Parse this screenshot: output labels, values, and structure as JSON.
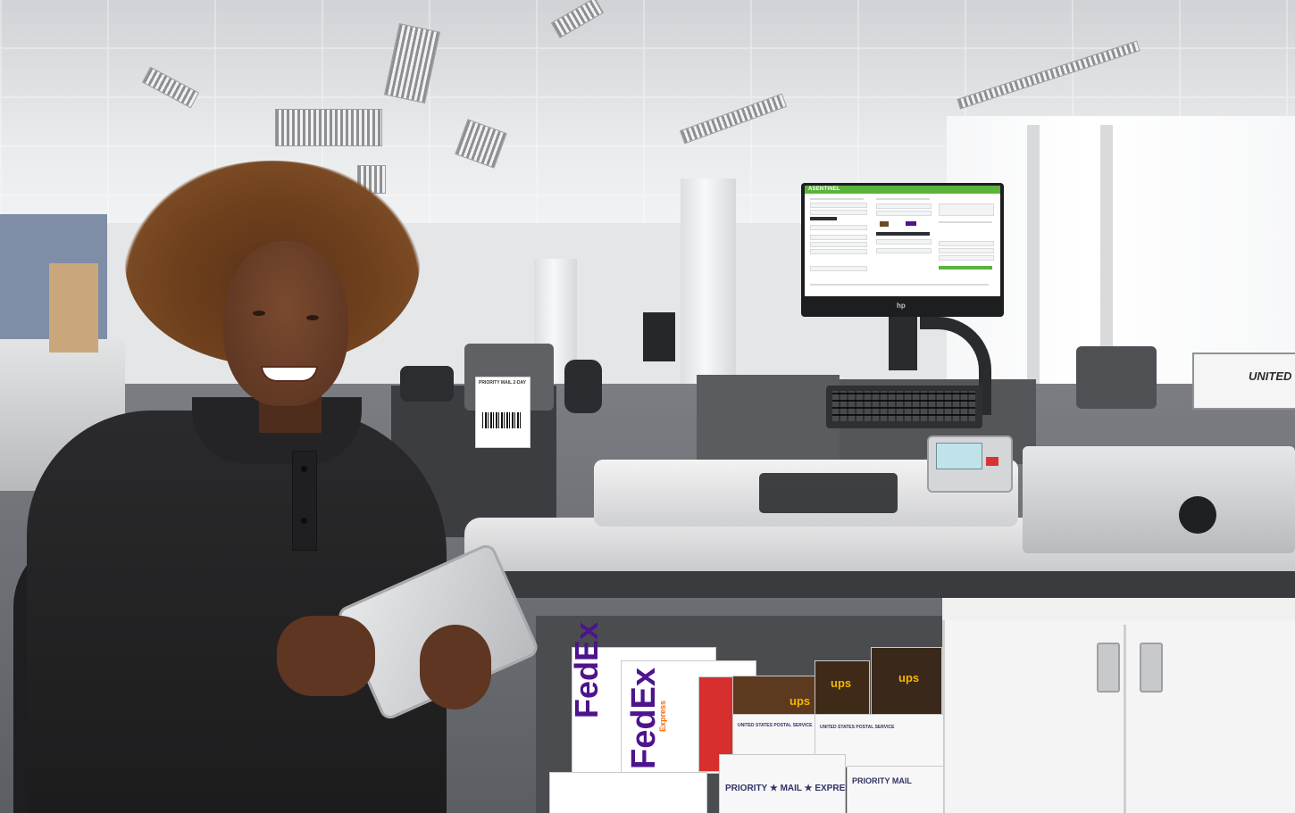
{
  "scene": {
    "description_free": true,
    "monitor": {
      "app_title": "ASENTINEL",
      "brand_logo": "hp"
    },
    "shipping_label": {
      "text": "PRIORITY MAIL 2-DAY"
    },
    "mail_tray": {
      "text": "UNITED"
    },
    "packages": {
      "fedex_1": "FedEx",
      "fedex_1_sub": "Express",
      "fedex_2": "FedEx",
      "fedex_2_sub": "Express",
      "fedex_3": "Express",
      "ups_1": "ups",
      "ups_2": "ups",
      "ups_3": "ups",
      "usps_1": "UNITED STATES POSTAL SERVICE",
      "usps_2": "UNITED STATES POSTAL SERVICE",
      "priority_1": "PRIORITY ★ MAIL ★ EXPRESS",
      "priority_2": "PRIORITY MAIL"
    },
    "colors": {
      "app_green": "#5ab33b",
      "fedex_purple": "#4d148c",
      "fedex_orange": "#ff6600",
      "ups_brown": "#5b3a1f",
      "ups_gold": "#f7b600",
      "usps_blue": "#333366",
      "usps_red": "#d22630"
    }
  }
}
